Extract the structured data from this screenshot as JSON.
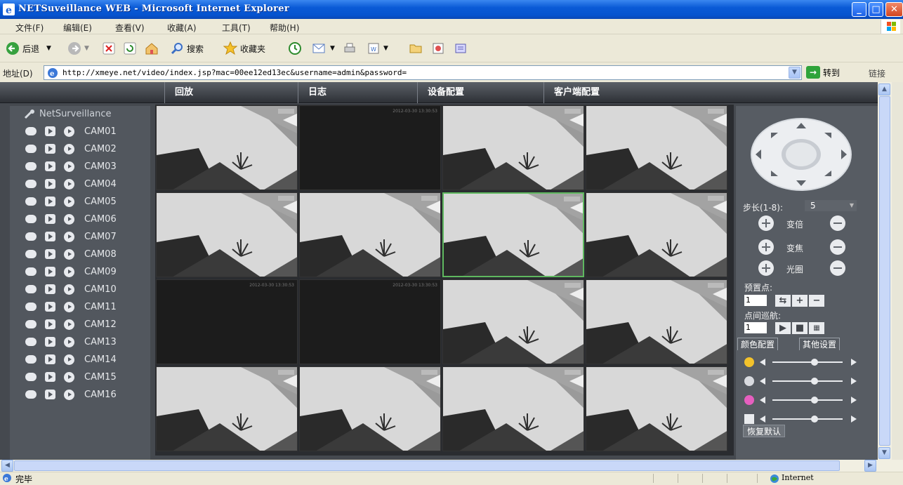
{
  "window": {
    "title": "NETSuveillance WEB - Microsoft Internet Explorer"
  },
  "menubar": {
    "items": [
      "文件(F)",
      "编辑(E)",
      "查看(V)",
      "收藏(A)",
      "工具(T)",
      "帮助(H)"
    ]
  },
  "toolbar": {
    "back": "后退",
    "search": "搜索",
    "favorites": "收藏夹"
  },
  "addressbar": {
    "label": "地址(D)",
    "url": "http://xmeye.net/video/index.jsp?mac=00ee12ed13ec&username=admin&password=",
    "go": "转到",
    "links": "链接"
  },
  "app": {
    "nav_tabs": [
      "回放",
      "日志",
      "设备配置",
      "客户端配置"
    ],
    "tree_title": "NetSurveillance",
    "cameras": [
      "CAM01",
      "CAM02",
      "CAM03",
      "CAM04",
      "CAM05",
      "CAM06",
      "CAM07",
      "CAM08",
      "CAM09",
      "CAM10",
      "CAM11",
      "CAM12",
      "CAM13",
      "CAM14",
      "CAM15",
      "CAM16"
    ],
    "grid": {
      "columns": 4,
      "rows": 4,
      "selected_index": 6,
      "dark_cells": [
        1,
        8,
        9
      ],
      "dark_timestamp": "2012-03-30 13:30:53"
    },
    "ptz": {
      "step_label": "步长(1-8):",
      "step_value": "5",
      "zoom_label": "变倍",
      "focus_label": "变焦",
      "iris_label": "光圈",
      "preset_label": "预置点:",
      "preset_value": "1",
      "tour_label": "点间巡航:",
      "tour_value": "1"
    },
    "color_tabs": [
      "颜色配置",
      "其他设置"
    ],
    "sliders": [
      {
        "name": "brightness",
        "value": 0.6
      },
      {
        "name": "contrast",
        "value": 0.6
      },
      {
        "name": "saturation",
        "value": 0.6
      },
      {
        "name": "hue",
        "value": 0.6
      }
    ],
    "reset_label": "恢复默认"
  },
  "statusbar": {
    "text": "完毕",
    "zone": "Internet"
  }
}
